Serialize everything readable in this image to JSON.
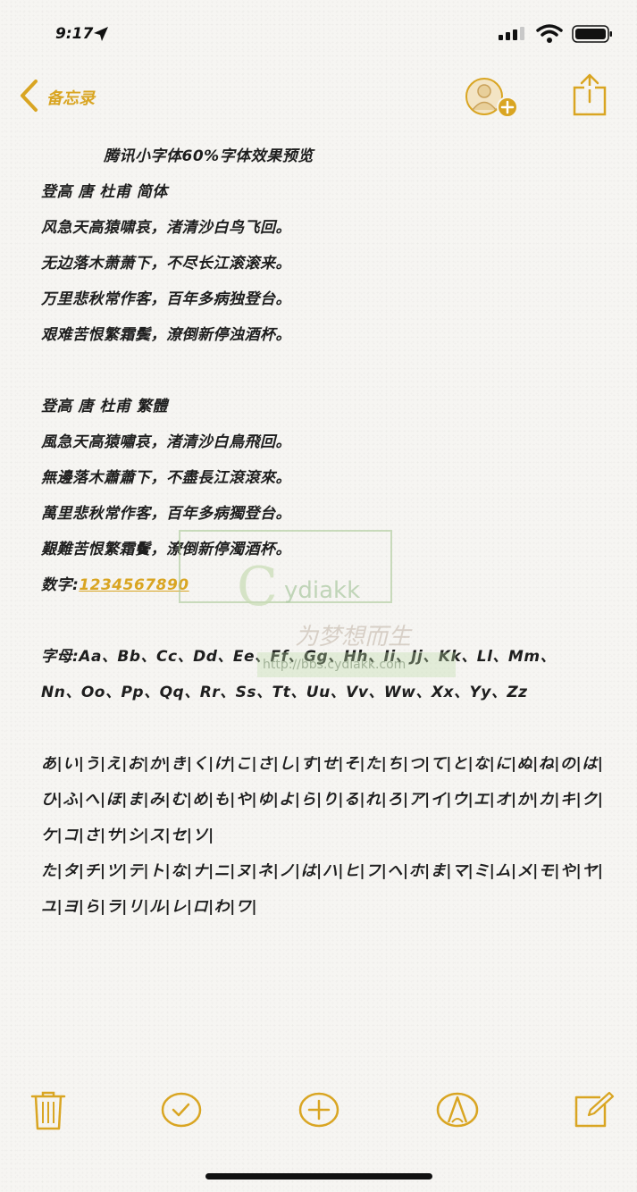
{
  "status_bar": {
    "time": "9:17"
  },
  "nav": {
    "back_label": "备忘录"
  },
  "note": {
    "lines": [
      "腾讯小字体60%字体效果预览",
      "登高 唐 杜甫 简体",
      "风急天高猿啸哀，渚清沙白鸟飞回。",
      "无边落木萧萧下，不尽长江滚滚来。",
      "万里悲秋常作客，百年多病独登台。",
      "艰难苦恨繁霜鬓，潦倒新停浊酒杯。",
      "",
      "登高 唐 杜甫 繁體",
      "風急天高猿嘯哀，渚清沙白鳥飛回。",
      "無邊落木蕭蕭下，不盡長江滾滾來。",
      "萬里悲秋常作客，百年多病獨登台。",
      "艱難苦恨繁霜鬢，潦倒新停濁酒杯。"
    ],
    "digits_label": "数字:",
    "digits_value": "1234567890",
    "letters_line1": "字母:Aa、Bb、Cc、Dd、Ee、Ff、Gg、Hh、Ii、Jj、Kk、Ll、Mm、",
    "letters_line2": "Nn、Oo、Pp、Qq、Rr、Ss、Tt、Uu、Vv、Ww、Xx、Yy、Zz",
    "kana_line1": "あ|い|う|え|お|か|き|く|け|こ|さ|し|す|せ|そ|た|ち|つ|て|と|な|に|ぬ|ね|の|は|",
    "kana_line2": "ひ|ふ|へ|ほ|ま|み|む|め|も|や|ゆ|よ|ら|り|る|れ|ろ|ア|イ|ウ|エ|オ|か|カ|キ|ク|",
    "kana_line3": "ケ|コ|さ|サ|シ|ス|セ|ソ|",
    "kana_line4": "た|タ|チ|ツ|テ|ト|な|ナ|ニ|ヌ|ネ|ノ|は|ハ|ヒ|フ|ヘ|ホ|ま|マ|ミ|ム|メ|モ|や|ヤ|",
    "kana_line5": "ユ|ヨ|ら|ラ|リ|ル|レ|ロ|わ|ワ|"
  },
  "watermark": {
    "brand": "ydiakk",
    "slogan": "为梦想而生",
    "url": "http://bbs.cydiakk.com"
  },
  "colors": {
    "accent": "#d9a522",
    "background": "#f6f5f2",
    "text": "#1e1e1e"
  },
  "toolbar": {
    "icons": [
      "trash-icon",
      "checklist-icon",
      "add-icon",
      "markup-icon",
      "compose-icon"
    ]
  }
}
